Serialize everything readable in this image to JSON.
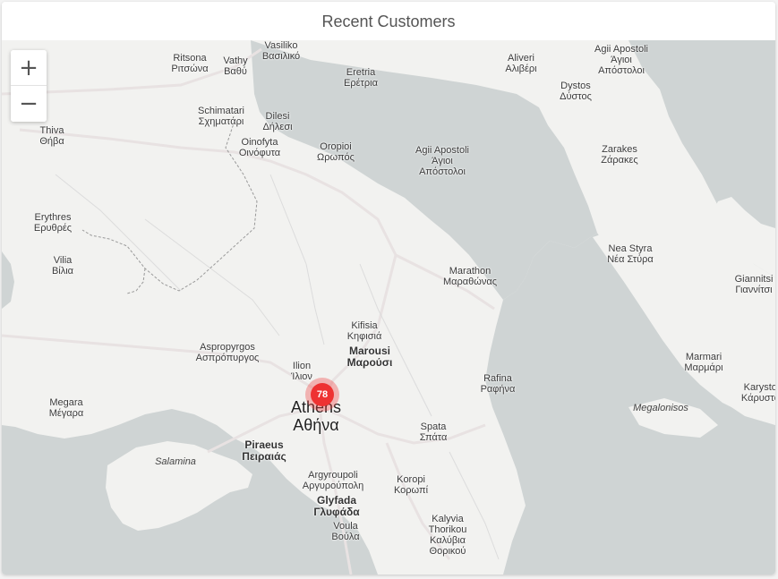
{
  "card": {
    "title": "Recent Customers"
  },
  "zoom": {
    "in_symbol": "+",
    "out_symbol": "−"
  },
  "cluster": {
    "count": "78",
    "color": "#ee3232"
  },
  "places": {
    "vasiliko": "Vasiliko\nΒασιλικό",
    "ritsona": "Ritsona\nΡιτσώνα",
    "vathy": "Vathy\nΒαθύ",
    "eretria": "Eretria\nΕρέτρια",
    "aliveri": "Aliveri\nΑλιβέρι",
    "agii_apostoli_ne": "Agii Apostoli\nΆγιοι\nΑπόστολοι",
    "dystos": "Dystos\nΔύστος",
    "schimatari": "Schimatari\nΣχηματάρι",
    "dilesi": "Dilesi\nΔήλεσι",
    "thiva": "Thiva\nΘήβα",
    "oinofyta": "Oinofyta\nΟινόφυτα",
    "oropioi": "Oropioi\nΩρωπός",
    "agii_apostoli": "Agii Apostoli\nΆγιοι\nΑπόστολοι",
    "zarakes": "Zarakes\nΖάρακες",
    "erythres": "Erythres\nΕρυθρές",
    "nea_styra": "Nea Styra\nΝέα Στύρα",
    "vilia": "Vilia\nΒίλια",
    "marathon": "Marathon\nΜαραθώνας",
    "giannitsi": "Giannitsi\nΓιαννίτσι",
    "kifisia": "Kifisia\nΚηφισιά",
    "aspropyrgos": "Aspropyrgos\nΑσπρόπυργος",
    "marousi": "Marousi\nΜαρούσι",
    "ilion": "Ilion\nΊλιον",
    "marmari": "Marmari\nΜαρμάρι",
    "rafina": "Rafina\nΡαφήνα",
    "karystos": "Karystos\nΚάρυστος",
    "megara": "Megara\nΜέγαρα",
    "athens": "Athens\nΑθήνα",
    "megalonisos": "Megalonisos",
    "spata": "Spata\nΣπάτα",
    "piraeus": "Piraeus\nΠειραιάς",
    "salamina": "Salamina",
    "argyroupoli": "Argyroupoli\nΑργυρούπολη",
    "koropi": "Koropi\nΚορωπί",
    "glyfada": "Glyfada\nΓλυφάδα",
    "voula": "Voula\nΒούλα",
    "kalyvia": "Kalyvia\nThorikou\nΚαλύβια\nΘορικού"
  }
}
